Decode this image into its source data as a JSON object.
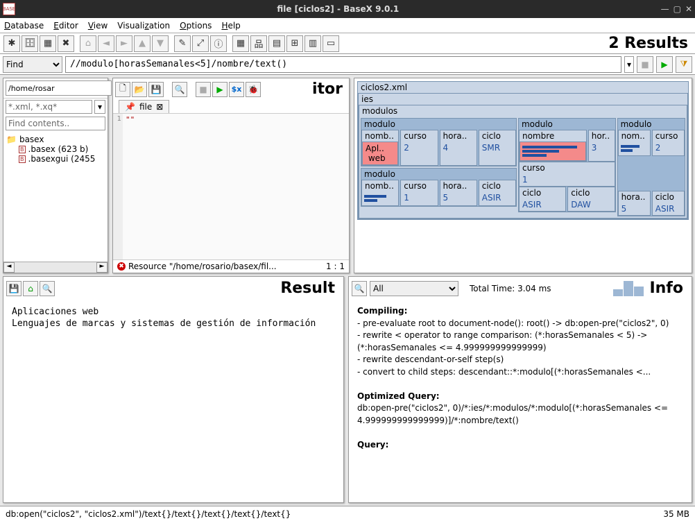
{
  "window": {
    "title": "file [ciclos2] - BaseX 9.0.1"
  },
  "menubar": [
    "Database",
    "Editor",
    "View",
    "Visualization",
    "Options",
    "Help"
  ],
  "results_label": "2 Results",
  "search": {
    "mode": "Find",
    "query": "//modulo[horasSemanales<5]/nombre/text()"
  },
  "filebrowser": {
    "path": "/home/rosar",
    "filter": "*.xml, *.xq*",
    "find": "Find contents..",
    "folder": "basex",
    "files": [
      ".basex (623 b)",
      ".basexgui (2455"
    ]
  },
  "editor": {
    "title": "itor",
    "tab": "file",
    "gutter": "1",
    "content": "\"\"",
    "status": "Resource \"/home/rosario/basex/fil...",
    "pos": "1 : 1"
  },
  "viz": {
    "root": "ciclos2.xml",
    "ies": "ies",
    "modulos": "modulos",
    "m1": {
      "label": "modulo",
      "nombre": "nomb..",
      "curso": "curso",
      "horas": "hora..",
      "ciclo": "ciclo",
      "nombre_v": "Apl..\n web",
      "curso_v": "2",
      "horas_v": "4",
      "ciclo_v": "SMR"
    },
    "m2": {
      "label": "modulo",
      "nombre": "nomb..",
      "curso": "curso",
      "horas": "hora..",
      "ciclo": "ciclo",
      "curso_v": "1",
      "horas_v": "5",
      "ciclo_v": "ASIR"
    },
    "m3": {
      "label": "modulo",
      "nombre": "nombre",
      "horas": "hor..",
      "horas_v": "3",
      "curso": "curso",
      "curso_v": "1",
      "c1": "ciclo",
      "c1v": "ASIR",
      "c2": "ciclo",
      "c2v": "DAW"
    },
    "m4": {
      "label": "modulo",
      "nombre": "nom..",
      "curso": "curso",
      "curso_v": "2",
      "horas": "hora..",
      "horas_v": "5",
      "ciclo": "ciclo",
      "ciclo_v": "ASIR"
    }
  },
  "result": {
    "title": "Result",
    "lines": "Aplicaciones web\nLenguajes de marcas y sistemas de gestión de información"
  },
  "info": {
    "title": "Info",
    "filter": "All",
    "total_time": "Total Time: 3.04 ms",
    "compiling_h": "Compiling:",
    "compiling": "- pre-evaluate root to document-node(): root() -> db:open-pre(\"ciclos2\", 0)\n- rewrite < operator to range comparison: (*:horasSemanales < 5) -> (*:horasSemanales <= 4.999999999999999)\n- rewrite descendant-or-self step(s)\n- convert to child steps: descendant::*:modulo[(*:horasSemanales <...",
    "optq_h": "Optimized Query:",
    "optq": "db:open-pre(\"ciclos2\", 0)/*:ies/*:modulos/*:modulo[(*:horasSemanales <= 4.999999999999999)]/*:nombre/text()",
    "query_h": "Query:"
  },
  "statusbar": {
    "path": "db:open(\"ciclos2\", \"ciclos2.xml\")/text{}/text{}/text{}/text{}/text{}",
    "mem": "35 MB"
  }
}
